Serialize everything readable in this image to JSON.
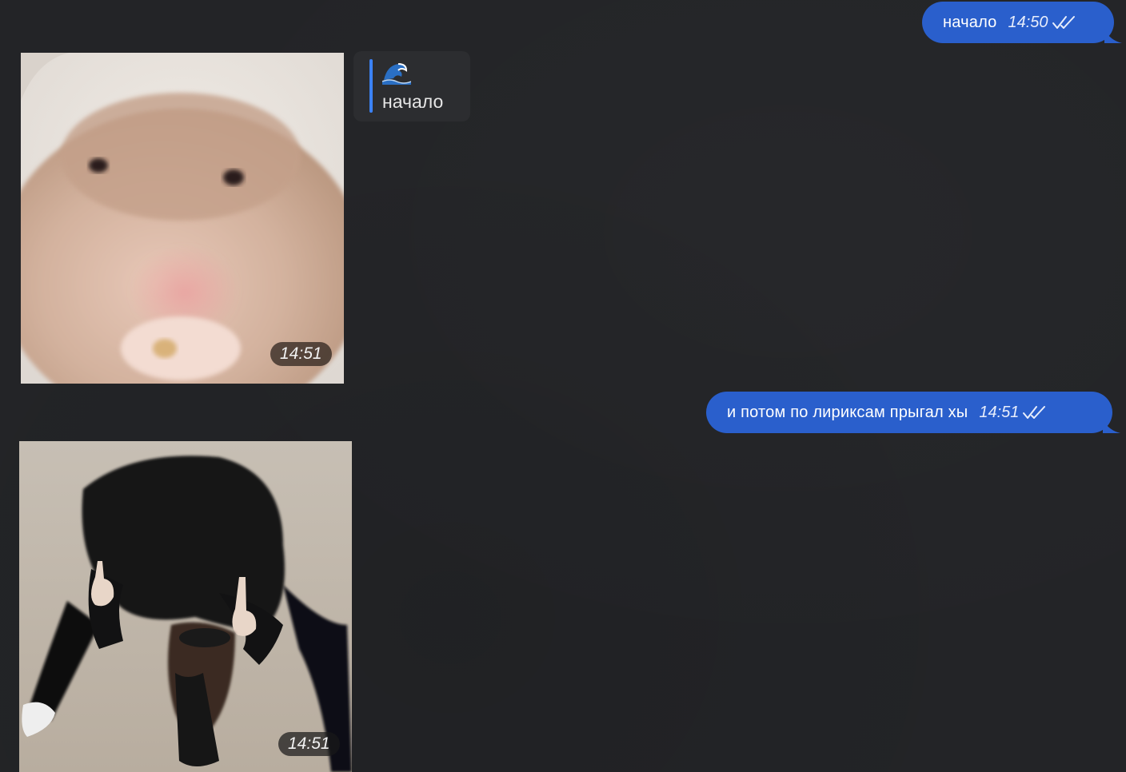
{
  "messages": {
    "out1": {
      "text": "начало",
      "time": "14:50",
      "status_icon": "double-check-icon"
    },
    "reply": {
      "emoji": "🌊",
      "text": "начало"
    },
    "photo1": {
      "time": "14:51",
      "subject": "hamster photo"
    },
    "out2": {
      "text": "и потом по лириксам прыгал хы",
      "time": "14:51",
      "status_icon": "double-check-icon"
    },
    "photo2": {
      "time": "14:51",
      "subject": "person bending over photo"
    }
  },
  "colors": {
    "background": "#232427",
    "outgoing_bubble": "#2a5fcc",
    "incoming_bubble": "#2c2d30",
    "quote_accent": "#3b82f6"
  }
}
